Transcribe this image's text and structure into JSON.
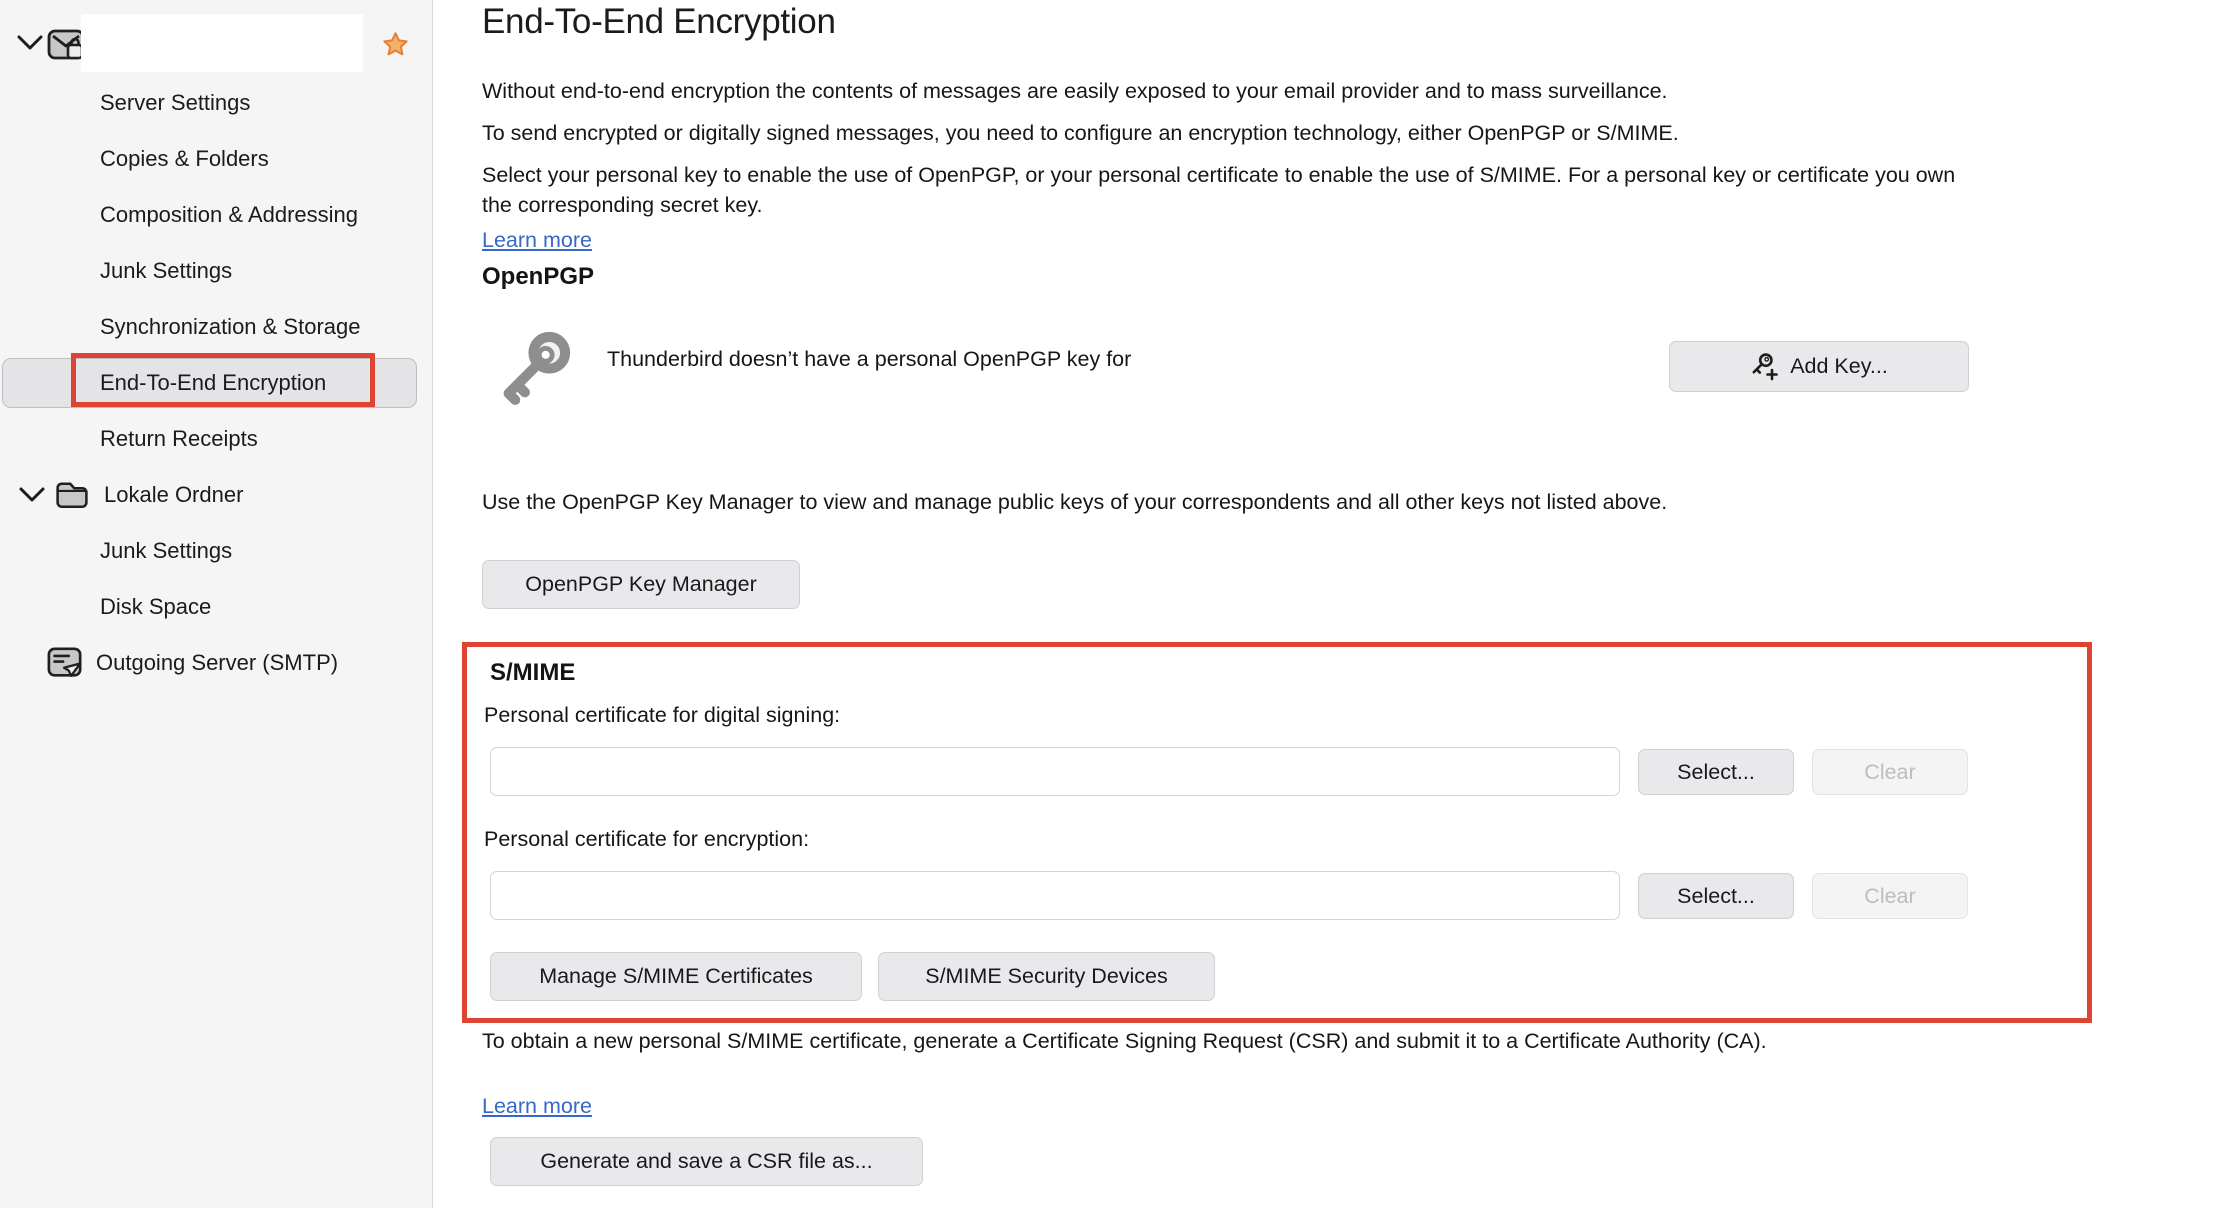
{
  "colors": {
    "annotation": "#dd4532",
    "link": "#3767c8",
    "star_fill": "#f5b06c",
    "star_stroke": "#e2823c"
  },
  "sidebar": {
    "account_items": [
      {
        "label": "Server Settings"
      },
      {
        "label": "Copies & Folders"
      },
      {
        "label": "Composition & Addressing"
      },
      {
        "label": "Junk Settings"
      },
      {
        "label": "Synchronization & Storage"
      },
      {
        "label": "End-To-End Encryption",
        "selected": true,
        "annotated": true
      },
      {
        "label": "Return Receipts"
      }
    ],
    "local_folders": {
      "label": "Lokale Ordner",
      "children": [
        {
          "label": "Junk Settings"
        },
        {
          "label": "Disk Space"
        }
      ]
    },
    "outgoing_server": {
      "label": "Outgoing Server (SMTP)"
    }
  },
  "main": {
    "title": "End-To-End Encryption",
    "intro": [
      "Without end-to-end encryption the contents of messages are easily exposed to your email provider and to mass surveillance.",
      "To send encrypted or digitally signed messages, you need to configure an encryption technology, either OpenPGP or S/MIME.",
      "Select your personal key to enable the use of OpenPGP, or your personal certificate to enable the use of S/MIME. For a personal key or certificate you own the corresponding secret key."
    ],
    "learn_more": "Learn more",
    "openpgp": {
      "heading": "OpenPGP",
      "status_text": "Thunderbird doesn’t have a personal OpenPGP key for",
      "add_key_button": "Add Key...",
      "manager_text": "Use the OpenPGP Key Manager to view and manage public keys of your correspondents and all other keys not listed above.",
      "manager_button": "OpenPGP Key Manager"
    },
    "smime": {
      "heading": "S/MIME",
      "signing_label": "Personal certificate for digital signing:",
      "signing_value": "",
      "encryption_label": "Personal certificate for encryption:",
      "encryption_value": "",
      "select_button": "Select...",
      "clear_button": "Clear",
      "manage_button": "Manage S/MIME Certificates",
      "devices_button": "S/MIME Security Devices"
    },
    "csr": {
      "text": "To obtain a new personal S/MIME certificate, generate a Certificate Signing Request (CSR) and submit it to a Certificate Authority (CA).",
      "learn_more": "Learn more",
      "generate_button": "Generate and save a CSR file as..."
    }
  }
}
